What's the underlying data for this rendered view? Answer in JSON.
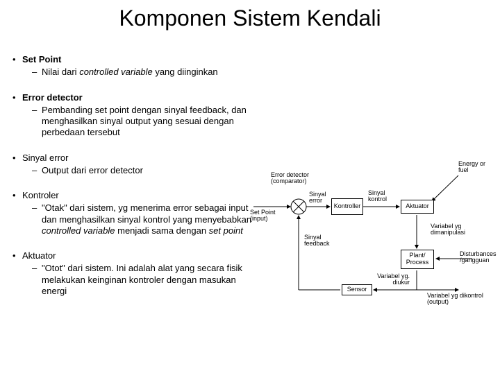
{
  "title": "Komponen Sistem Kendali",
  "bullets": {
    "b1": {
      "head": "Set Point",
      "sub": "Nilai dari controlled variable yang diinginkan"
    },
    "b2": {
      "head": "Error detector",
      "sub": "Pembanding set point dengan sinyal feedback, dan menghasilkan sinyal output yang sesuai dengan perbedaan tersebut"
    },
    "b3": {
      "head": "Sinyal error",
      "sub": "Output dari error detector"
    },
    "b4": {
      "head": "Kontroler",
      "sub": "\"Otak\" dari sistem, yg menerima error sebagai input dan menghasilkan sinyal kontrol yang menyebabkan controlled variable menjadi sama dengan set point"
    },
    "b5": {
      "head": "Aktuator",
      "sub": "\"Otot\" dari sistem. Ini adalah alat yang secara fisik melakukan keinginan kontroler dengan masukan energi"
    }
  },
  "diagram": {
    "error_detector_caption": "Error detector (comparator)",
    "set_point_arrow": "Set Point (input)",
    "sinyal_error": "Sinyal error",
    "kontroler": "Kontroller",
    "sinyal_kontrol": "Sinyal kontrol",
    "aktuator": "Aktuator",
    "energy": "Energy or fuel",
    "variabel_manip": "Variabel yg dimanipulasi",
    "plant": "Plant/ Process",
    "disturb": "Disturbances /gangguan",
    "var_dikontrol": "Variabel yg dikontrol (output)",
    "sensor": "Sensor",
    "var_diukur": "Variabel yg. diukur",
    "sinyal_feedback": "Sinyal feedback"
  }
}
